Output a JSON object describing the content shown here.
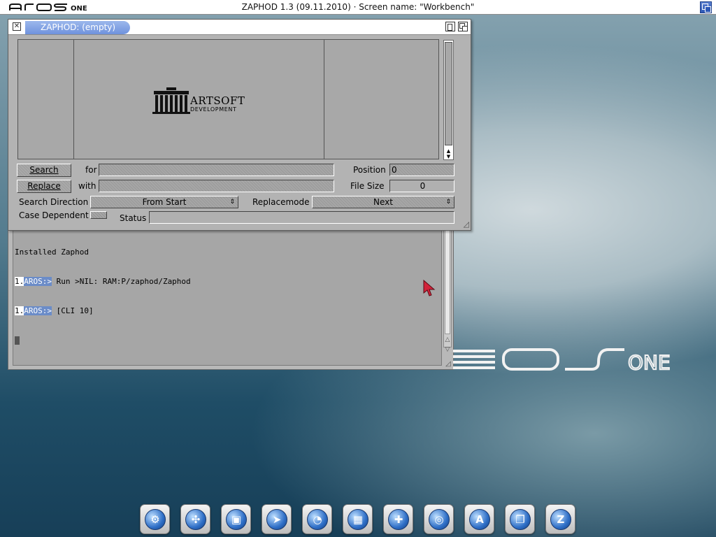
{
  "screen": {
    "title": "ZAPHOD 1.3 (09.11.2010) · Screen name: \"Workbench\"",
    "logo_icon": "aros-one-logo"
  },
  "zaphod_window": {
    "title": "ZAPHOD: (empty)",
    "logo_name": "ARTSOFT",
    "logo_sub": "DEVELOPMENT",
    "search_button": "Search",
    "for_label": "for",
    "search_value": "",
    "replace_button": "Replace",
    "with_label": "with",
    "replace_value": "",
    "position_label": "Position",
    "position_value": "0",
    "filesize_label": "File Size",
    "filesize_value": "0",
    "search_direction_label": "Search Direction",
    "search_direction_value": "From Start",
    "replacemode_label": "Replacemode",
    "replacemode_value": "Next",
    "case_dependent_label": "Case Dependent",
    "status_label": "Status",
    "status_value": ""
  },
  "shell": {
    "lines": [
      {
        "num": "",
        "prompt": "",
        "text": "Installed Zaphod"
      },
      {
        "num": "1.",
        "prompt": "AROS:>",
        "text": " Run >NIL: RAM:P/zaphod/Zaphod"
      },
      {
        "num": "1.",
        "prompt": "AROS:>",
        "text": " [CLI 10]"
      }
    ]
  },
  "dock": {
    "items": [
      {
        "icon": "system-prefs-icon",
        "glyph": "⚙"
      },
      {
        "icon": "network-icon",
        "glyph": "✣"
      },
      {
        "icon": "display-icon",
        "glyph": "▣"
      },
      {
        "icon": "pointer-icon",
        "glyph": "➤"
      },
      {
        "icon": "clock-icon",
        "glyph": "◔"
      },
      {
        "icon": "browser-icon",
        "glyph": "▦"
      },
      {
        "icon": "calculator-icon",
        "glyph": "✚"
      },
      {
        "icon": "web-browser-icon",
        "glyph": "◎"
      },
      {
        "icon": "fonts-icon",
        "glyph": "A"
      },
      {
        "icon": "windows-icon",
        "glyph": "❐"
      },
      {
        "icon": "zaphod-icon",
        "glyph": "Z"
      }
    ]
  }
}
